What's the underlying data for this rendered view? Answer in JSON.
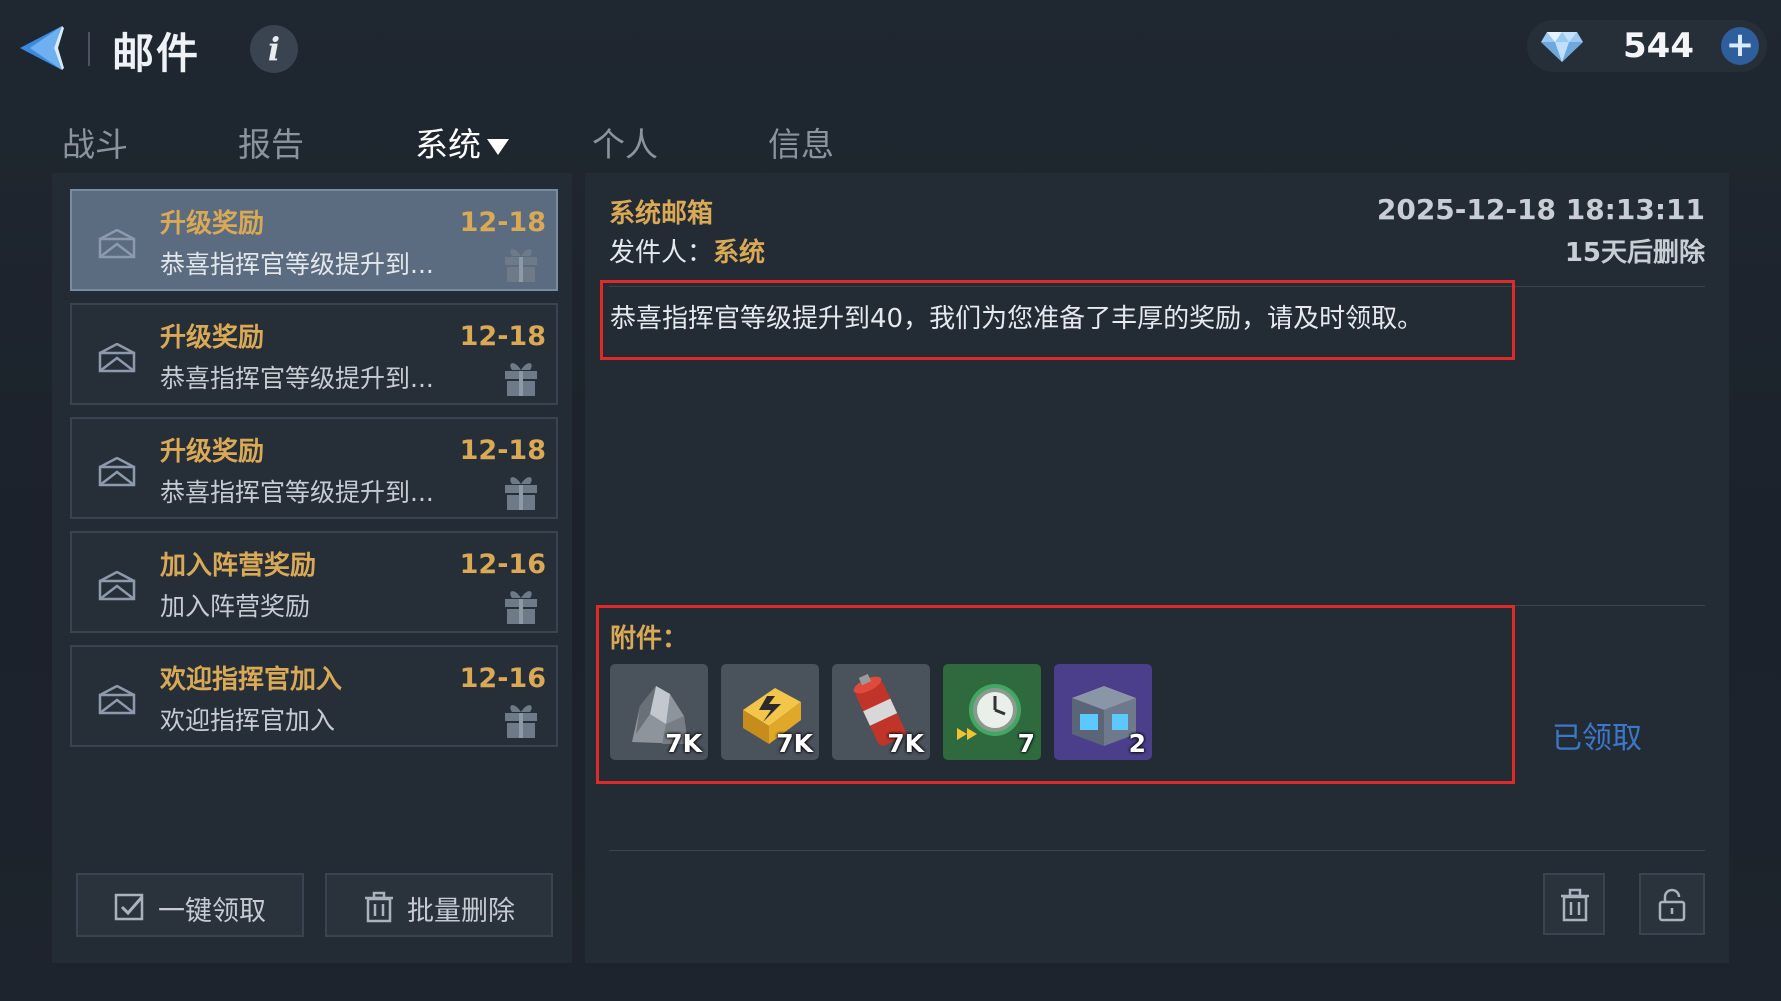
{
  "header": {
    "title": "邮件",
    "info_label": "i",
    "currency_value": "544",
    "add_label": "+"
  },
  "tabs": [
    {
      "label": "战斗",
      "active": false
    },
    {
      "label": "报告",
      "active": false
    },
    {
      "label": "系统",
      "active": true
    },
    {
      "label": "个人",
      "active": false
    },
    {
      "label": "信息",
      "active": false
    }
  ],
  "mail_list": [
    {
      "title": "升级奖励",
      "date": "12-18",
      "preview": "恭喜指挥官等级提升到...",
      "selected": true
    },
    {
      "title": "升级奖励",
      "date": "12-18",
      "preview": "恭喜指挥官等级提升到...",
      "selected": false
    },
    {
      "title": "升级奖励",
      "date": "12-18",
      "preview": "恭喜指挥官等级提升到...",
      "selected": false
    },
    {
      "title": "加入阵营奖励",
      "date": "12-16",
      "preview": "加入阵营奖励",
      "selected": false
    },
    {
      "title": "欢迎指挥官加入",
      "date": "12-16",
      "preview": "欢迎指挥官加入",
      "selected": false
    }
  ],
  "left_actions": {
    "claim_all_label": "一键领取",
    "batch_delete_label": "批量删除"
  },
  "detail": {
    "mailbox_name": "系统邮箱",
    "sender_prefix": "发件人：",
    "sender": "系统",
    "timestamp": "2025-12-18 18:13:11",
    "delete_note": "15天后删除",
    "body": "恭喜指挥官等级提升到40，我们为您准备了丰厚的奖励，请及时领取。",
    "attachments_label": "附件：",
    "attachments": [
      {
        "icon": "stone-ore-icon",
        "qty": "7K",
        "bg": "#4a525c"
      },
      {
        "icon": "energy-battery-icon",
        "qty": "7K",
        "bg": "#4a525c"
      },
      {
        "icon": "fuel-canister-icon",
        "qty": "7K",
        "bg": "#4a525c"
      },
      {
        "icon": "speedup-stopwatch-icon",
        "qty": "7",
        "bg": "#2f6a3f"
      },
      {
        "icon": "supply-chest-icon",
        "qty": "2",
        "bg": "#4b3f8c"
      }
    ],
    "claimed_status": "已领取"
  },
  "colors": {
    "accent_gold": "#d9a955",
    "highlight_red": "#e02a2a",
    "claimed_blue": "#3b78c8",
    "selected_item": "#5b6b80"
  }
}
